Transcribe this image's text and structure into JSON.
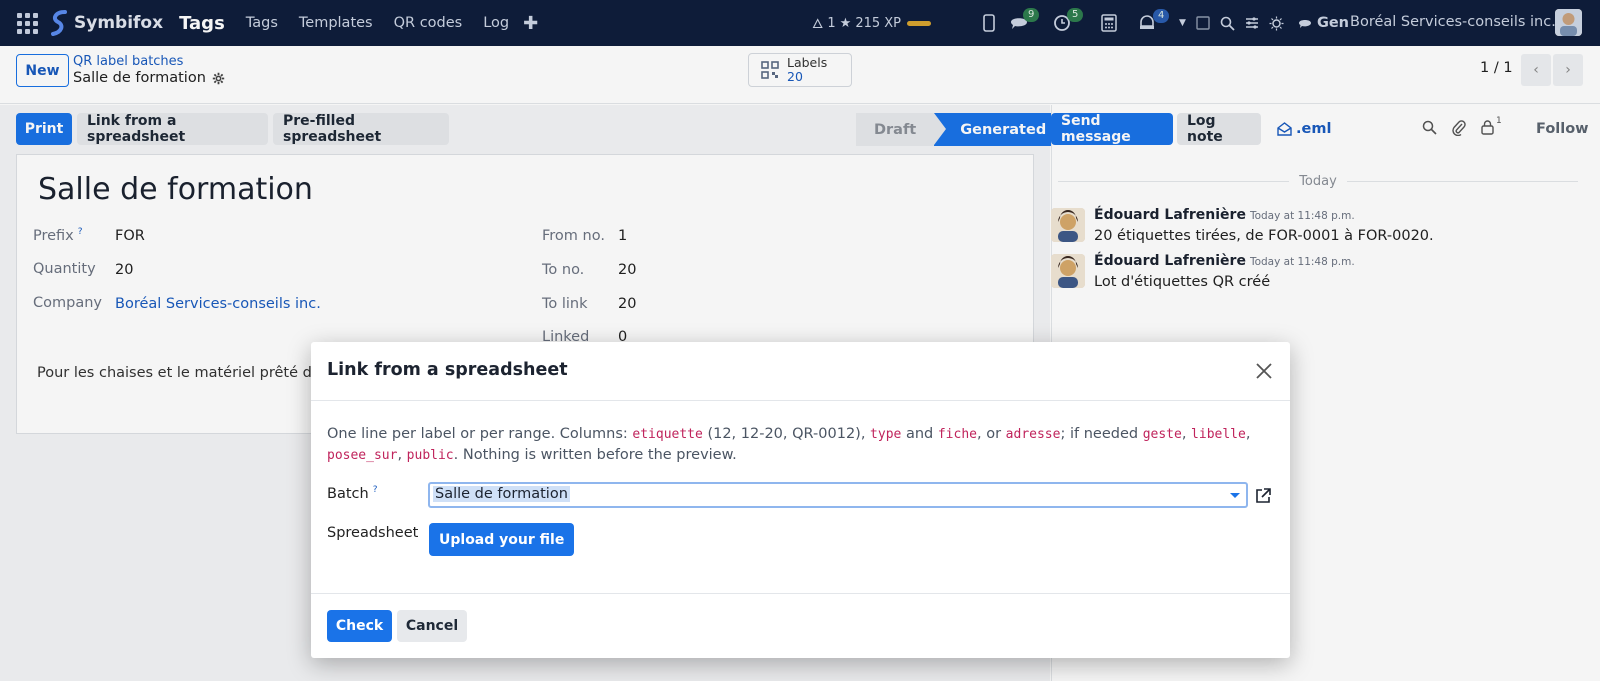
{
  "navbar": {
    "brand": "Symbifox",
    "app_title": "Tags",
    "menu": [
      "Tags",
      "Templates",
      "QR codes",
      "Log"
    ],
    "streak": "1",
    "xp": "215 XP",
    "messages_count": "9",
    "activities_count": "5",
    "notifications_count": "4",
    "ai_label": "Gen",
    "company": "Boréal Services-conseils inc."
  },
  "control": {
    "new_label": "New",
    "breadcrumb_parent": "QR label batches",
    "breadcrumb_current": "Salle de formation",
    "stat_label": "Labels",
    "stat_value": "20",
    "pager": "1 / 1"
  },
  "actions": {
    "print": "Print",
    "link_sheet": "Link from a spreadsheet",
    "prefilled": "Pre-filled spreadsheet"
  },
  "status": {
    "draft": "Draft",
    "generated": "Generated",
    "active": "Generated"
  },
  "form": {
    "title": "Salle de formation",
    "prefix_label": "Prefix",
    "prefix_help": "?",
    "prefix": "FOR",
    "quantity_label": "Quantity",
    "quantity": "20",
    "company_label": "Company",
    "company": "Boréal Services-conseils inc.",
    "from_label": "From no.",
    "from": "1",
    "to_label": "To no.",
    "to": "20",
    "to_link_label": "To link",
    "to_link": "20",
    "linked_label": "Linked",
    "linked": "0",
    "description": "Pour les chaises et le matériel prêté de la"
  },
  "chatter": {
    "send_message": "Send message",
    "log_note": "Log note",
    "eml": ".eml",
    "followers_count": "1",
    "follow": "Follow",
    "today": "Today",
    "messages": [
      {
        "author": "Édouard Lafrenière",
        "date": "Today at 11:48 p.m.",
        "body": "20 étiquettes tirées, de FOR-0001 à FOR-0020."
      },
      {
        "author": "Édouard Lafrenière",
        "date": "Today at 11:48 p.m.",
        "body": "Lot d'étiquettes QR créé"
      }
    ]
  },
  "modal": {
    "title": "Link from a spreadsheet",
    "intro_1": "One line per label or per range. Columns: ",
    "code_etiquette": "etiquette",
    "intro_2": " (12, 12-20, QR-0012), ",
    "code_type": "type",
    "intro_3": " and ",
    "code_fiche": "fiche",
    "intro_4": ", or ",
    "code_adresse": "adresse",
    "intro_5": "; if needed ",
    "code_geste": "geste",
    "sep1": ", ",
    "code_libelle": "libelle",
    "sep2": ",",
    "code_posee_sur": "posee_sur",
    "sep3": ", ",
    "code_public": "public",
    "intro_6": ". Nothing is written before the preview.",
    "batch_label": "Batch",
    "batch_help": "?",
    "batch_value": "Salle de formation",
    "spreadsheet_label": "Spreadsheet",
    "upload_label": "Upload your file",
    "check_label": "Check",
    "cancel_label": "Cancel"
  },
  "colors": {
    "navbar": "#0f1e3c",
    "primary": "#1a73e8",
    "link": "#1a5bbf",
    "code": "#c0245c"
  }
}
